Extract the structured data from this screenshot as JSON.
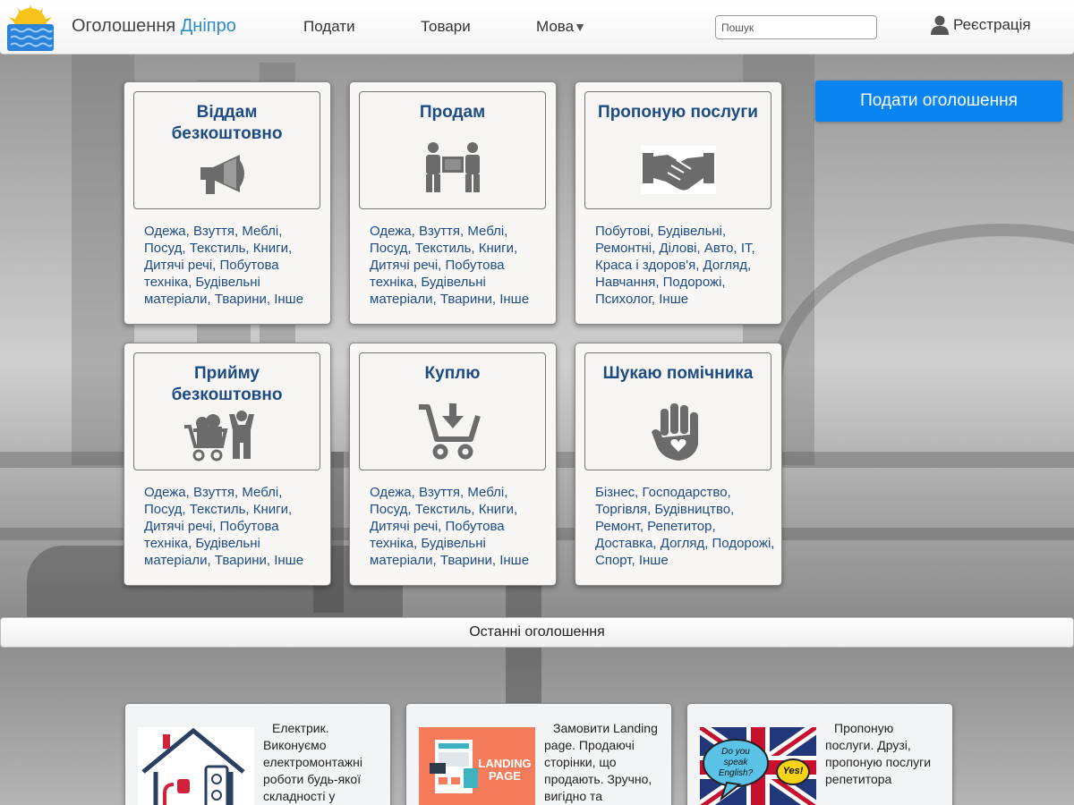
{
  "header": {
    "brand_main": "Оголошення",
    "brand_city": "Дніпро",
    "nav": [
      {
        "label": "Подати"
      },
      {
        "label": "Товари"
      },
      {
        "label": "Мова",
        "caret": "▼"
      }
    ],
    "search_placeholder": "Пошук",
    "register_label": "Реєстрація",
    "register_icon": "user-icon"
  },
  "post_button_label": "Подати оголошення",
  "categories": [
    {
      "title": "Віддам безкоштовно",
      "icon": "megaphone-icon",
      "desc": "Одежа, Взуття, Меблі, Посуд, Текстиль, Книги, Дитячі речі, Побутова техніка, Будівельні матеріали, Тварини, Інше"
    },
    {
      "title": "Продам",
      "icon": "movers-box-icon",
      "desc": "Одежа, Взуття, Меблі, Посуд, Текстиль, Книги, Дитячі речі, Побутова техніка, Будівельні матеріали, Тварини, Інше"
    },
    {
      "title": "Пропоную послуги",
      "icon": "handshake-icon",
      "desc": "Побутові, Будівельні, Ремонтні, Ділові, Авто, IT, Краса і здоров'я, Догляд, Навчання, Подорожі, Психолог, Інше"
    },
    {
      "title": "Прийму безкоштовно",
      "icon": "cart-person-icon",
      "desc": "Одежа, Взуття, Меблі, Посуд, Текстиль, Книги, Дитячі речі, Побутова техніка, Будівельні матеріали, Тварини, Інше"
    },
    {
      "title": "Куплю",
      "icon": "cart-download-icon",
      "desc": "Одежа, Взуття, Меблі, Посуд, Текстиль, Книги, Дитячі речі, Побутова техніка, Будівельні матеріали, Тварини, Інше"
    },
    {
      "title": "Шукаю помічника",
      "icon": "hand-heart-icon",
      "desc": "Бізнес, Господарство, Торгівля, Будівництво, Ремонт, Репетитор, Доставка, Догляд, Подорожі, Спорт, Інше"
    }
  ],
  "latest_title": "Останні оголошення",
  "ads": [
    {
      "text": "Електрик. Виконуємо електромонтажні роботи будь-якої складності у",
      "thumb": "electric-house-icon"
    },
    {
      "text": "Замовити Landing page. Продаючі сторінки, що продають. Зручно, вигідно та",
      "thumb": "landing-page-image",
      "thumb_label": "LANDING PAGE"
    },
    {
      "text": "Пропоную послуги. Друзі, пропоную послуги репетитора",
      "thumb": "english-flag-image",
      "bubble1": "Do you speak English?",
      "bubble2": "Yes!"
    }
  ],
  "colors": {
    "accent_blue": "#0a84f0",
    "brand_city": "#2e8bc9",
    "category_text": "#1d4b84",
    "icon_gray": "#6b6b6b"
  }
}
